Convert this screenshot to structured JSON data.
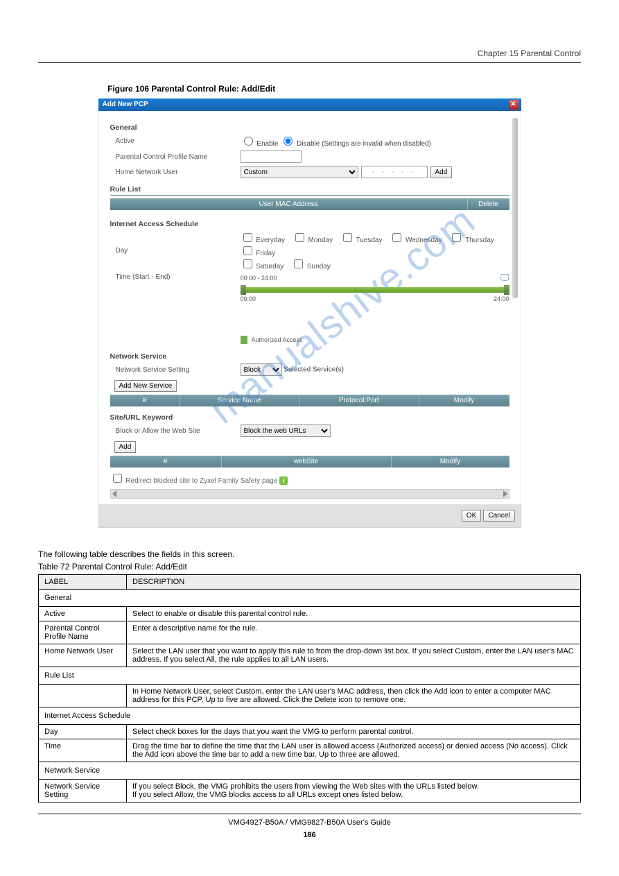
{
  "chapter": "Chapter 15 Parental Control",
  "figureCaption": "Figure 106   Parental Control Rule: Add/Edit",
  "watermark": "manualshive.com",
  "dialog": {
    "title": "Add New PCP",
    "closeGlyph": "✕",
    "general": {
      "heading": "General",
      "active": {
        "label": "Active",
        "enableLabel": "Enable",
        "disableLabel": "Disable (Settings are invalid when disabled)"
      },
      "profileName": {
        "label": "Parental Control Profile Name",
        "value": ""
      },
      "homeUser": {
        "label": "Home Network User",
        "selected": "Custom",
        "macPlaceholder": "- - - - -",
        "addBtn": "Add"
      }
    },
    "ruleList": {
      "heading": "Rule List",
      "th1": "User MAC Address",
      "th2": "Delete"
    },
    "schedule": {
      "heading": "Internet Access Schedule",
      "dayLabel": "Day",
      "days": [
        "Everyday",
        "Monday",
        "Tuesday",
        "Wednesday",
        "Thursday",
        "Friday",
        "Saturday",
        "Sunday"
      ],
      "timeLabel": "Time (Start - End)",
      "rangeText": "00:00 - 24:00",
      "startText": "00:00",
      "endText": "24:00",
      "clockGlyph": "🖵",
      "authAccess": "Authorized Access"
    },
    "service": {
      "heading": "Network Service",
      "settingLabel": "Network Service Setting",
      "selected": "Block",
      "selectedSuffix": " Selected Service(s)",
      "addBtn": "Add New Service",
      "th1": "#",
      "th2": "Service Name",
      "th3": "Protocol:Port",
      "th4": "Modify"
    },
    "site": {
      "heading": "Site/URL Keyword",
      "blockAllowLabel": "Block or Allow the Web Site",
      "selected": "Block the web URLs",
      "addBtn": "Add",
      "th1": "#",
      "th2": "webSite",
      "th3": "Modify",
      "redirectLabel": "Redirect blocked site to Zyxel Family Safety page",
      "infoGlyph": "i"
    },
    "okBtn": "OK",
    "cancelBtn": "Cancel"
  },
  "description": "The following table describes the fields in this screen.",
  "table": {
    "caption": "Table 72   Parental Control Rule: Add/Edit",
    "head": {
      "c1": "LABEL",
      "c2": "DESCRIPTION"
    },
    "rows": [
      {
        "type": "section",
        "text": "General"
      },
      {
        "c1": "Active",
        "c2": "Select to enable or disable this parental control rule."
      },
      {
        "c1": "Parental Control Profile Name",
        "c2": "Enter a descriptive name for the rule."
      },
      {
        "c1": "Home Network User",
        "c2": "Select the LAN user that you want to apply this rule to from the drop-down list box. If you select Custom, enter the LAN user's MAC address. If you select All, the rule applies to all LAN users."
      },
      {
        "type": "section",
        "text": "Rule List"
      },
      {
        "sub": true,
        "c2": "In Home Network User, select Custom, enter the LAN user's MAC address, then click the Add icon to enter a computer MAC address for this PCP. Up to five are allowed. Click the Delete icon to remove one."
      },
      {
        "type": "section",
        "text": "Internet Access Schedule"
      },
      {
        "c1": "Day",
        "c2": "Select check boxes for the days that you want the VMG to perform parental control."
      },
      {
        "c1": "Time",
        "c2": "Drag the time bar to define the time that the LAN user is allowed access (Authorized access) or denied access (No access). Click the Add icon above the time bar to add a new time bar. Up to three are allowed."
      },
      {
        "type": "section",
        "text": "Network Service"
      },
      {
        "c1": "Network Service Setting",
        "c2": "If you select Block, the VMG prohibits the users from viewing the Web sites with the URLs listed below.\nIf you select Allow, the VMG blocks access to all URLs except ones listed below."
      }
    ]
  },
  "footer": {
    "title": "VMG4927-B50A / VMG9827-B50A User's Guide",
    "page": "186"
  }
}
